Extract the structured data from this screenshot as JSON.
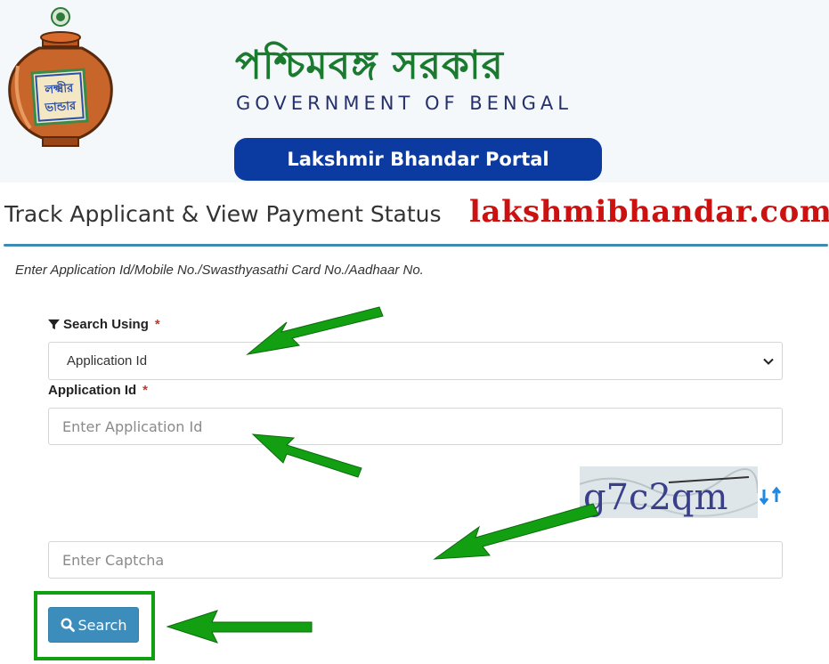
{
  "header": {
    "bengali_title": "পশ্চিমবঙ্গ সরকার",
    "english_title": "GOVERNMENT OF BENGAL",
    "portal_label": "Lakshmir Bhandar Portal"
  },
  "page": {
    "title": "Track Applicant & View Payment Status",
    "watermark": "lakshmibhandar.com",
    "instruction": "Enter Application Id/Mobile No./Swasthyasathi Card No./Aadhaar No."
  },
  "form": {
    "search_using_label": "Search Using",
    "required_mark": "*",
    "search_using_value": "Application Id",
    "application_id_label": "Application Id",
    "application_id_placeholder": "Enter Application Id",
    "captcha_placeholder": "Enter Captcha",
    "captcha_text": "g7c2qm",
    "search_label": "Search"
  },
  "colors": {
    "brand_blue": "#0b3aa0",
    "title_green": "#1a7a2e",
    "button_blue": "#3c8dbc",
    "arrow_green": "#12a012",
    "watermark_red": "#cc1111"
  },
  "icons": {
    "filter": "filter-icon",
    "search": "search-icon",
    "refresh": "refresh-icon",
    "chevron": "chevron-down-icon"
  }
}
